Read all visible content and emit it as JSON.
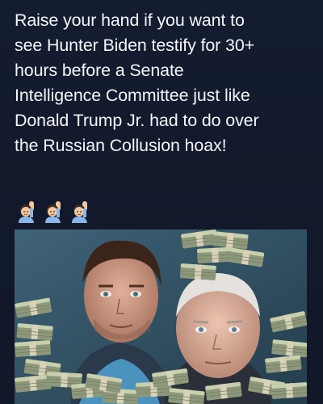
{
  "post": {
    "text": "Raise your hand if you want to\nsee Hunter Biden testify for 30+\nhours before a Senate\nIntelligence Committee just like\nDonald Trump Jr. had to do over\nthe Russian Collusion hoax!",
    "emoji_count": 3,
    "emoji_icon": "person-raising-hand-icon"
  },
  "photo": {
    "description_icon": "two-men-surrounded-by-cash-stacks",
    "colors": {
      "background": "#131a2d",
      "text": "#f4f6fb",
      "money": "#a9b38a"
    }
  }
}
